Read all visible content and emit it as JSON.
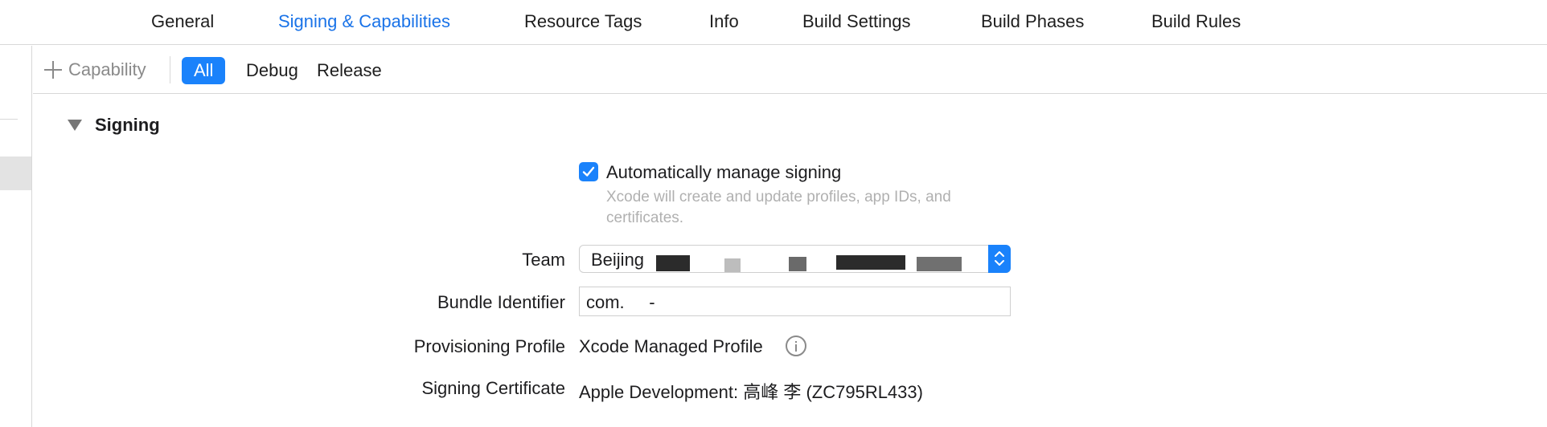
{
  "tabs": {
    "general": "General",
    "signing": "Signing & Capabilities",
    "resource_tags": "Resource Tags",
    "info": "Info",
    "build_settings": "Build Settings",
    "build_phases": "Build Phases",
    "build_rules": "Build Rules",
    "active": "Signing & Capabilities"
  },
  "filter_bar": {
    "capability_label": "Capability",
    "all": "All",
    "debug": "Debug",
    "release": "Release",
    "selected": "All"
  },
  "signing": {
    "section_title": "Signing",
    "auto_manage_label": "Automatically manage signing",
    "auto_manage_checked": true,
    "auto_manage_hint": "Xcode will create and update profiles, app IDs, and certificates.",
    "team_label": "Team",
    "team_value": "Beijing",
    "bundle_id_label": "Bundle Identifier",
    "bundle_id_value": "com.     -",
    "profile_label": "Provisioning Profile",
    "profile_value": "Xcode Managed Profile",
    "certificate_label": "Signing Certificate",
    "certificate_value": "Apple Development: 高峰 李 (ZC795RL433)"
  },
  "colors": {
    "accent": "#1a82fb",
    "active_tab": "#1a73e8",
    "hint_text": "#b0b0b0"
  },
  "icons": [
    "plus-icon",
    "disclosure-triangle-icon",
    "checkmark-icon",
    "up-down-chevron-icon",
    "info-icon"
  ]
}
